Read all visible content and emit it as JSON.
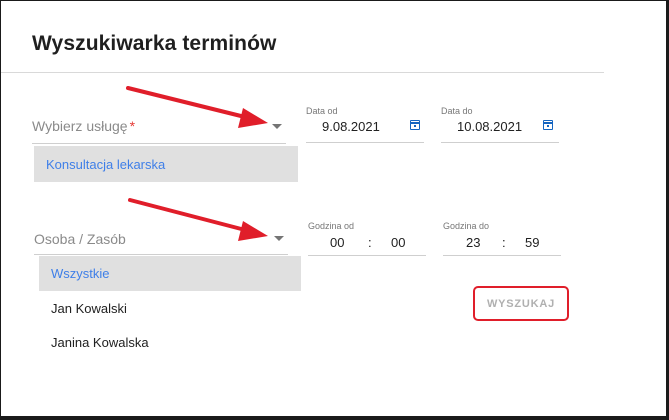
{
  "page": {
    "title": "Wyszukiwarka terminów"
  },
  "service_select": {
    "label": "Wybierz usługę",
    "required_mark": "*",
    "options": [
      "Konsultacja lekarska"
    ]
  },
  "date_from": {
    "label": "Data od",
    "value": "9.08.2021"
  },
  "date_to": {
    "label": "Data do",
    "value": "10.08.2021"
  },
  "person_select": {
    "label": "Osoba / Zasób",
    "options": [
      "Wszystkie",
      "Jan Kowalski",
      "Janina Kowalska"
    ]
  },
  "time_from": {
    "label": "Godzina od",
    "hours": "00",
    "separator": ":",
    "minutes": "00"
  },
  "time_to": {
    "label": "Godzina do",
    "hours": "23",
    "separator": ":",
    "minutes": "59"
  },
  "search_button": {
    "label": "WYSZUKAJ"
  },
  "annotation_color": "#e01e2a",
  "accent_color": "#3f7fe8"
}
